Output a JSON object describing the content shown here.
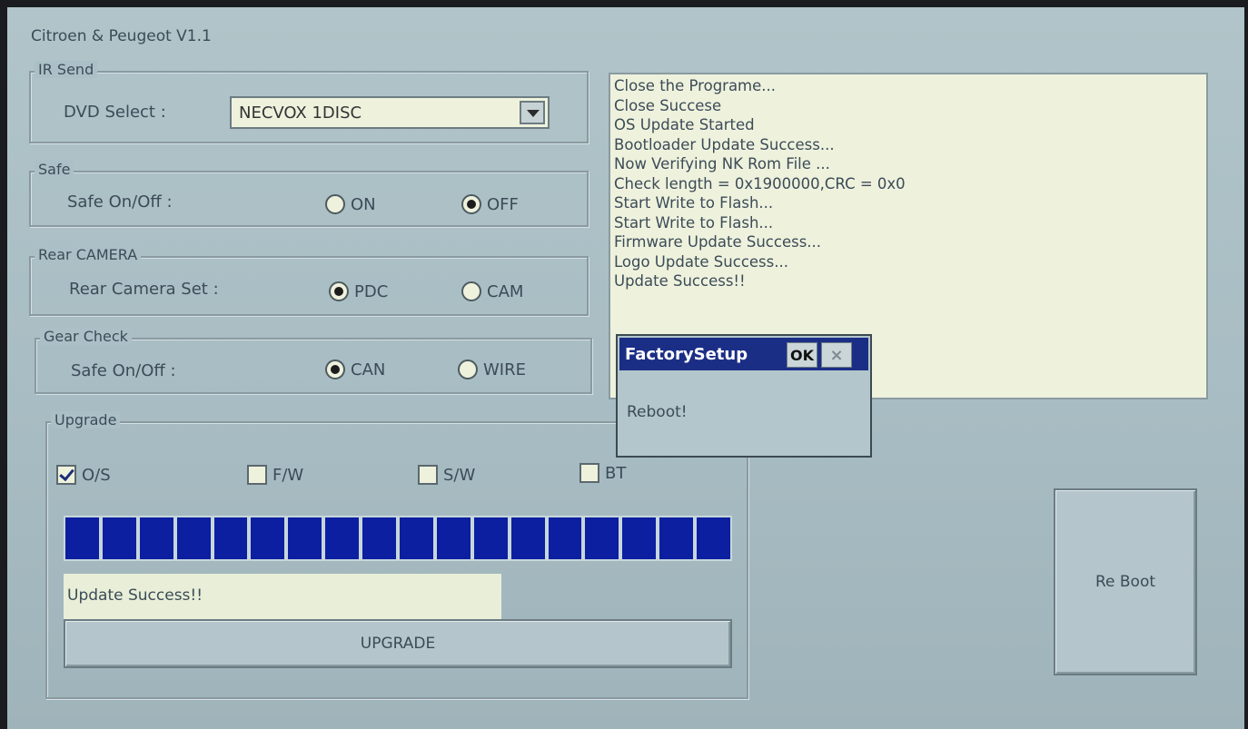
{
  "app": {
    "title": "Citroen & Peugeot V1.1"
  },
  "ir_send": {
    "group_title": "IR Send",
    "dvd_select_label": "DVD Select :",
    "dvd_select_value": "NECVOX 1DISC"
  },
  "safe": {
    "group_title": "Safe",
    "label": "Safe On/Off :",
    "options": [
      "ON",
      "OFF"
    ],
    "selected": "OFF"
  },
  "rear_camera": {
    "group_title": "Rear CAMERA",
    "label": "Rear Camera Set :",
    "options": [
      "PDC",
      "CAM"
    ],
    "selected": "PDC"
  },
  "gear_check": {
    "group_title": "Gear Check",
    "label": "Safe On/Off :",
    "options": [
      "CAN",
      "WIRE"
    ],
    "selected": "CAN"
  },
  "upgrade": {
    "group_title": "Upgrade",
    "checkboxes": [
      {
        "label": "O/S",
        "checked": true
      },
      {
        "label": "F/W",
        "checked": false
      },
      {
        "label": "S/W",
        "checked": false
      },
      {
        "label": "BT",
        "checked": false
      }
    ],
    "progress_fraction": 1.0,
    "progress_segments": 18,
    "status_text": "Update Success!!",
    "button_label": "UPGRADE"
  },
  "log": {
    "lines": [
      "Close the Programe...",
      "Close Succese",
      "OS Update Started",
      "Bootloader Update Success...",
      "Now Verifying NK Rom File ...",
      "Check length = 0x1900000,CRC = 0x0",
      "Start Write to Flash...",
      "Start Write to Flash...",
      "Firmware Update Success...",
      "Logo Update Success...",
      "Update Success!!"
    ]
  },
  "dialog": {
    "title": "FactorySetup",
    "ok_label": "OK",
    "close_glyph": "×",
    "message": "Reboot!"
  },
  "reboot_button": {
    "label": "Re Boot"
  },
  "colors": {
    "screen_bg": "#a9bec4",
    "progress_fill": "#0b1fa0",
    "dialog_title_bg": "#1b2e86",
    "log_bg": "#eef2dd"
  }
}
